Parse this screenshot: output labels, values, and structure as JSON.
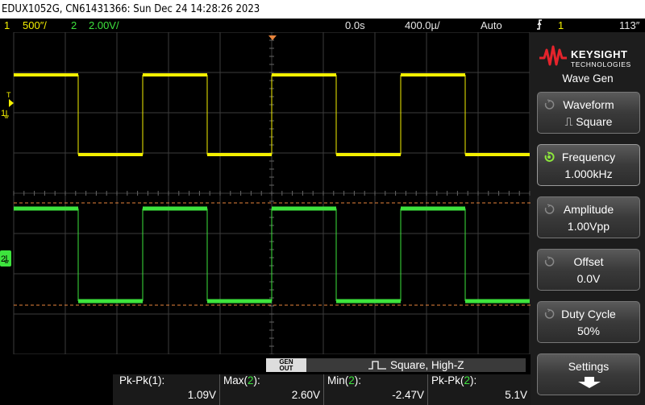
{
  "titlebar": {
    "text": "EDUX1052G, CN61431366: Sun Dec 24 14:28:26 2023"
  },
  "status": {
    "ch1_num": "1",
    "ch1_scale": "500″/",
    "ch2_num": "2",
    "ch2_scale": "2.00V/",
    "delay": "0.0s",
    "timebase": "400.0µ/",
    "mode": "Auto",
    "trig_src": "1",
    "trig_level": "113″"
  },
  "colors": {
    "ch1": "#f4f000",
    "ch2": "#3de33d",
    "grid": "#444444",
    "ref": "#e8843c"
  },
  "markers": {
    "trigger": "T",
    "ch1": "1",
    "ch2": "2"
  },
  "panel": {
    "brand": "KEYSIGHT",
    "brand_sub": "TECHNOLOGIES",
    "title": "Wave Gen",
    "keys": [
      {
        "label": "Waveform",
        "value": "⎍ Square"
      },
      {
        "label": "Frequency",
        "value": "1.000kHz"
      },
      {
        "label": "Amplitude",
        "value": "1.00Vpp"
      },
      {
        "label": "Offset",
        "value": "0.0V"
      },
      {
        "label": "Duty Cycle",
        "value": "50%"
      },
      {
        "label": "Settings",
        "value": ""
      }
    ]
  },
  "gen": {
    "label_top": "GEN",
    "label_bottom": "OUT",
    "info": "Square, High-Z"
  },
  "measurements": [
    {
      "label": "Pk-Pk(1):",
      "value": "1.09V"
    },
    {
      "label": "Max(2):",
      "value": "2.60V"
    },
    {
      "label": "Min(2):",
      "value": "-2.47V"
    },
    {
      "label": "Pk-Pk(2):",
      "value": "5.1V"
    }
  ]
}
